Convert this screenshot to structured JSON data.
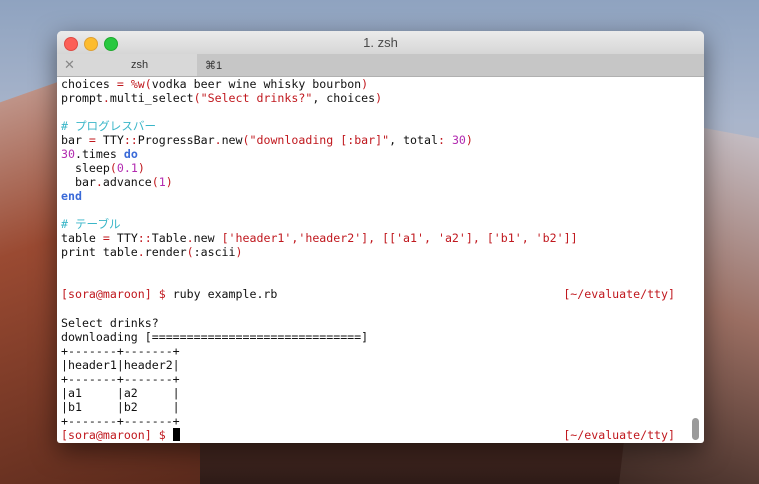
{
  "window": {
    "title": "1. zsh",
    "tab": {
      "label": "zsh",
      "shortcut": "⌘1",
      "close": "✕"
    }
  },
  "colors": {
    "red": "#c0181e",
    "purple": "#b22ab0",
    "blue": "#3a6ad8",
    "cyan": "#3ab6c8"
  },
  "lines": [
    {
      "segs": [
        {
          "t": "choices ",
          "c": "blk"
        },
        {
          "t": "=",
          "c": "red"
        },
        {
          "t": " ",
          "c": "blk"
        },
        {
          "t": "%w(",
          "c": "red"
        },
        {
          "t": "vodka beer wine whisky bourbon",
          "c": "blk"
        },
        {
          "t": ")",
          "c": "red"
        }
      ]
    },
    {
      "segs": [
        {
          "t": "prompt",
          "c": "blk"
        },
        {
          "t": ".",
          "c": "red"
        },
        {
          "t": "multi_select",
          "c": "blk"
        },
        {
          "t": "(",
          "c": "red"
        },
        {
          "t": "\"Select drinks?\"",
          "c": "red"
        },
        {
          "t": ", choices",
          "c": "blk"
        },
        {
          "t": ")",
          "c": "red"
        }
      ]
    },
    {
      "segs": []
    },
    {
      "segs": [
        {
          "t": "# プログレスバー",
          "c": "cyn"
        }
      ]
    },
    {
      "segs": [
        {
          "t": "bar ",
          "c": "blk"
        },
        {
          "t": "=",
          "c": "red"
        },
        {
          "t": " TTY",
          "c": "blk"
        },
        {
          "t": "::",
          "c": "red"
        },
        {
          "t": "ProgressBar",
          "c": "blk"
        },
        {
          "t": ".",
          "c": "red"
        },
        {
          "t": "new",
          "c": "blk"
        },
        {
          "t": "(",
          "c": "red"
        },
        {
          "t": "\"downloading [:bar]\"",
          "c": "red"
        },
        {
          "t": ", total",
          "c": "blk"
        },
        {
          "t": ":",
          "c": "red"
        },
        {
          "t": " ",
          "c": "blk"
        },
        {
          "t": "30",
          "c": "pur"
        },
        {
          "t": ")",
          "c": "red"
        }
      ]
    },
    {
      "segs": [
        {
          "t": "30",
          "c": "pur"
        },
        {
          "t": ".times ",
          "c": "blk"
        },
        {
          "t": "do",
          "c": "blu"
        }
      ]
    },
    {
      "segs": [
        {
          "t": "  sleep",
          "c": "blk"
        },
        {
          "t": "(",
          "c": "red"
        },
        {
          "t": "0.1",
          "c": "pur"
        },
        {
          "t": ")",
          "c": "red"
        }
      ]
    },
    {
      "segs": [
        {
          "t": "  bar",
          "c": "blk"
        },
        {
          "t": ".",
          "c": "red"
        },
        {
          "t": "advance",
          "c": "blk"
        },
        {
          "t": "(",
          "c": "red"
        },
        {
          "t": "1",
          "c": "pur"
        },
        {
          "t": ")",
          "c": "red"
        }
      ]
    },
    {
      "segs": [
        {
          "t": "end",
          "c": "blu"
        }
      ]
    },
    {
      "segs": []
    },
    {
      "segs": [
        {
          "t": "# テーブル",
          "c": "cyn"
        }
      ]
    },
    {
      "segs": [
        {
          "t": "table ",
          "c": "blk"
        },
        {
          "t": "=",
          "c": "red"
        },
        {
          "t": " TTY",
          "c": "blk"
        },
        {
          "t": "::",
          "c": "red"
        },
        {
          "t": "Table",
          "c": "blk"
        },
        {
          "t": ".",
          "c": "red"
        },
        {
          "t": "new ",
          "c": "blk"
        },
        {
          "t": "['header1','header2'], [['a1', 'a2'], ['b1', 'b2']]",
          "c": "red"
        }
      ]
    },
    {
      "segs": [
        {
          "t": "print table",
          "c": "blk"
        },
        {
          "t": ".",
          "c": "red"
        },
        {
          "t": "render",
          "c": "blk"
        },
        {
          "t": "(",
          "c": "red"
        },
        {
          "t": ":ascii",
          "c": "blk"
        },
        {
          "t": ")",
          "c": "red"
        }
      ]
    },
    {
      "segs": []
    },
    {
      "segs": []
    },
    {
      "segs": [
        {
          "t": "[sora@maroon] $ ",
          "c": "red"
        },
        {
          "t": "ruby example.rb",
          "c": "blk"
        }
      ],
      "right": "[~/evaluate/tty]"
    },
    {
      "segs": []
    },
    {
      "segs": [
        {
          "t": "Select drinks?",
          "c": "blk"
        }
      ]
    },
    {
      "segs": [
        {
          "t": "downloading [==============================]",
          "c": "blk"
        }
      ]
    },
    {
      "segs": [
        {
          "t": "+-------+-------+",
          "c": "blk"
        }
      ]
    },
    {
      "segs": [
        {
          "t": "|header1|header2|",
          "c": "blk"
        }
      ]
    },
    {
      "segs": [
        {
          "t": "+-------+-------+",
          "c": "blk"
        }
      ]
    },
    {
      "segs": [
        {
          "t": "|a1     |a2     |",
          "c": "blk"
        }
      ]
    },
    {
      "segs": [
        {
          "t": "|b1     |b2     |",
          "c": "blk"
        }
      ]
    },
    {
      "segs": [
        {
          "t": "+-------+-------+",
          "c": "blk"
        }
      ]
    },
    {
      "segs": [
        {
          "t": "[sora@maroon] $ ",
          "c": "red"
        }
      ],
      "right": "[~/evaluate/tty]",
      "cursor": true
    }
  ]
}
